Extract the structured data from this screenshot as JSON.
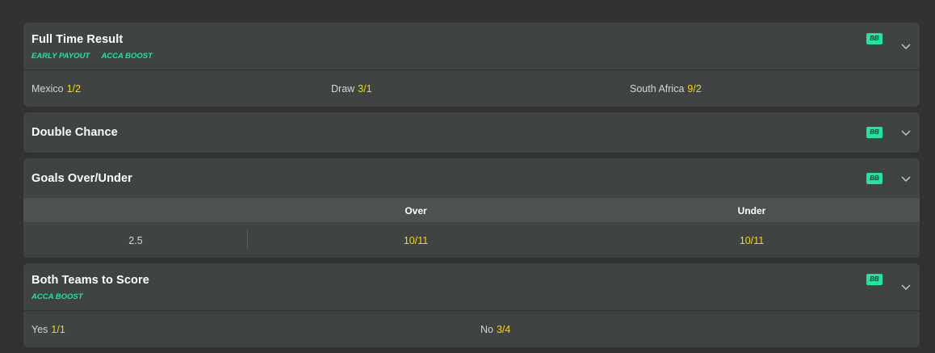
{
  "markets": {
    "full_time_result": {
      "title": "Full Time Result",
      "badges": [
        "EARLY PAYOUT",
        "ACCA BOOST"
      ],
      "bb": "BB",
      "selections": [
        {
          "name": "Mexico",
          "odds": "1/2"
        },
        {
          "name": "Draw",
          "odds": "3/1"
        },
        {
          "name": "South Africa",
          "odds": "9/2"
        }
      ]
    },
    "double_chance": {
      "title": "Double Chance",
      "bb": "BB"
    },
    "goals_over_under": {
      "title": "Goals Over/Under",
      "bb": "BB",
      "columns": [
        "Over",
        "Under"
      ],
      "line": "2.5",
      "over_odds": "10/11",
      "under_odds": "10/11"
    },
    "both_teams_to_score": {
      "title": "Both Teams to Score",
      "badges": [
        "ACCA BOOST"
      ],
      "bb": "BB",
      "selections": [
        {
          "name": "Yes",
          "odds": "1/1"
        },
        {
          "name": "No",
          "odds": "3/4"
        }
      ]
    }
  },
  "colors": {
    "background": "#303130",
    "panel": "#3f4341",
    "accent_green": "#1ee6a2",
    "odds_yellow": "#f5d90c"
  },
  "icons": {
    "expand": "chevron-down-icon",
    "bet_builder": "bb-badge"
  }
}
